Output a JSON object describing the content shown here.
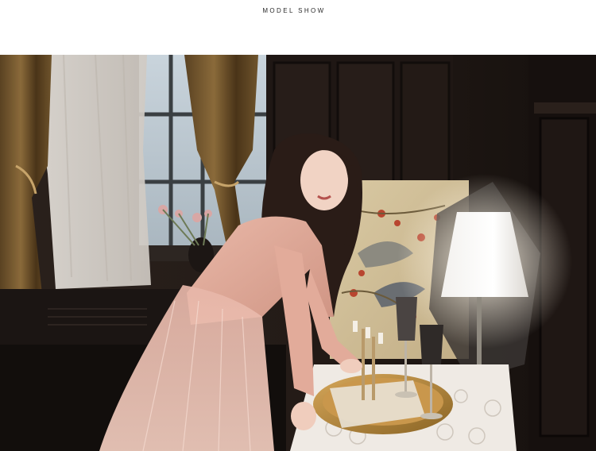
{
  "header": {
    "title": "MODEL SHOW"
  },
  "photo": {
    "subject": "model-show-photo"
  }
}
